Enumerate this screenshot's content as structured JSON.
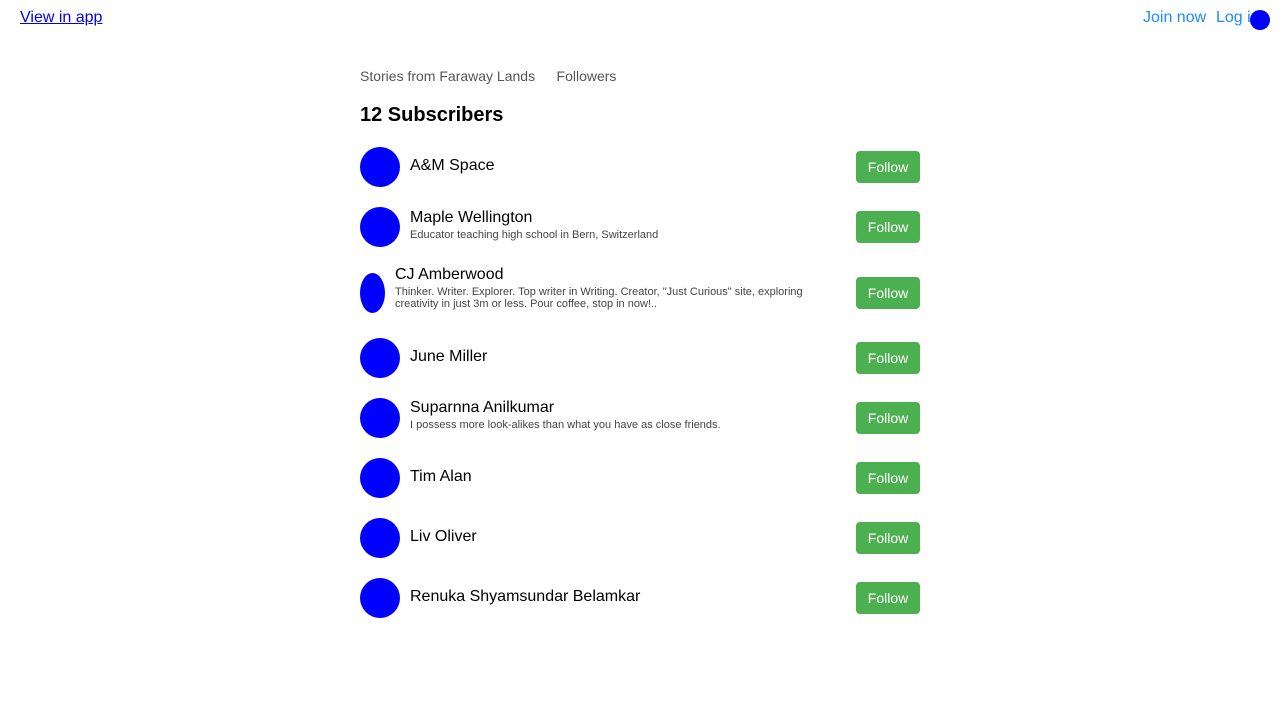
{
  "topbar": {
    "view_in_app": "View in app",
    "join_now": "Join now",
    "log_in": "Log in"
  },
  "nav": {
    "items": [
      "Stories from Faraway Lands",
      "Followers"
    ]
  },
  "heading": "12 Subscribers",
  "follow_label": "Follow",
  "colors": {
    "avatar": "#0000ff",
    "follow_button": "#4caf50",
    "link": "#1a8cff"
  },
  "subscribers": [
    {
      "name": "A&M Space",
      "bio": ""
    },
    {
      "name": "Maple Wellington",
      "bio": "Educator teaching high school in Bern, Switzerland"
    },
    {
      "name": "CJ Amberwood",
      "bio": "Thinker. Writer. Explorer. Top writer in Writing. Creator, \"Just Curious\" site, exploring creativity in just 3m or less. Pour coffee, stop in now!.."
    },
    {
      "name": "June Miller",
      "bio": ""
    },
    {
      "name": "Suparnna Anilkumar",
      "bio": "I possess more look-alikes than what you have as close friends."
    },
    {
      "name": "Tim Alan",
      "bio": ""
    },
    {
      "name": "Liv Oliver",
      "bio": ""
    },
    {
      "name": "Renuka Shyamsundar Belamkar",
      "bio": ""
    }
  ]
}
